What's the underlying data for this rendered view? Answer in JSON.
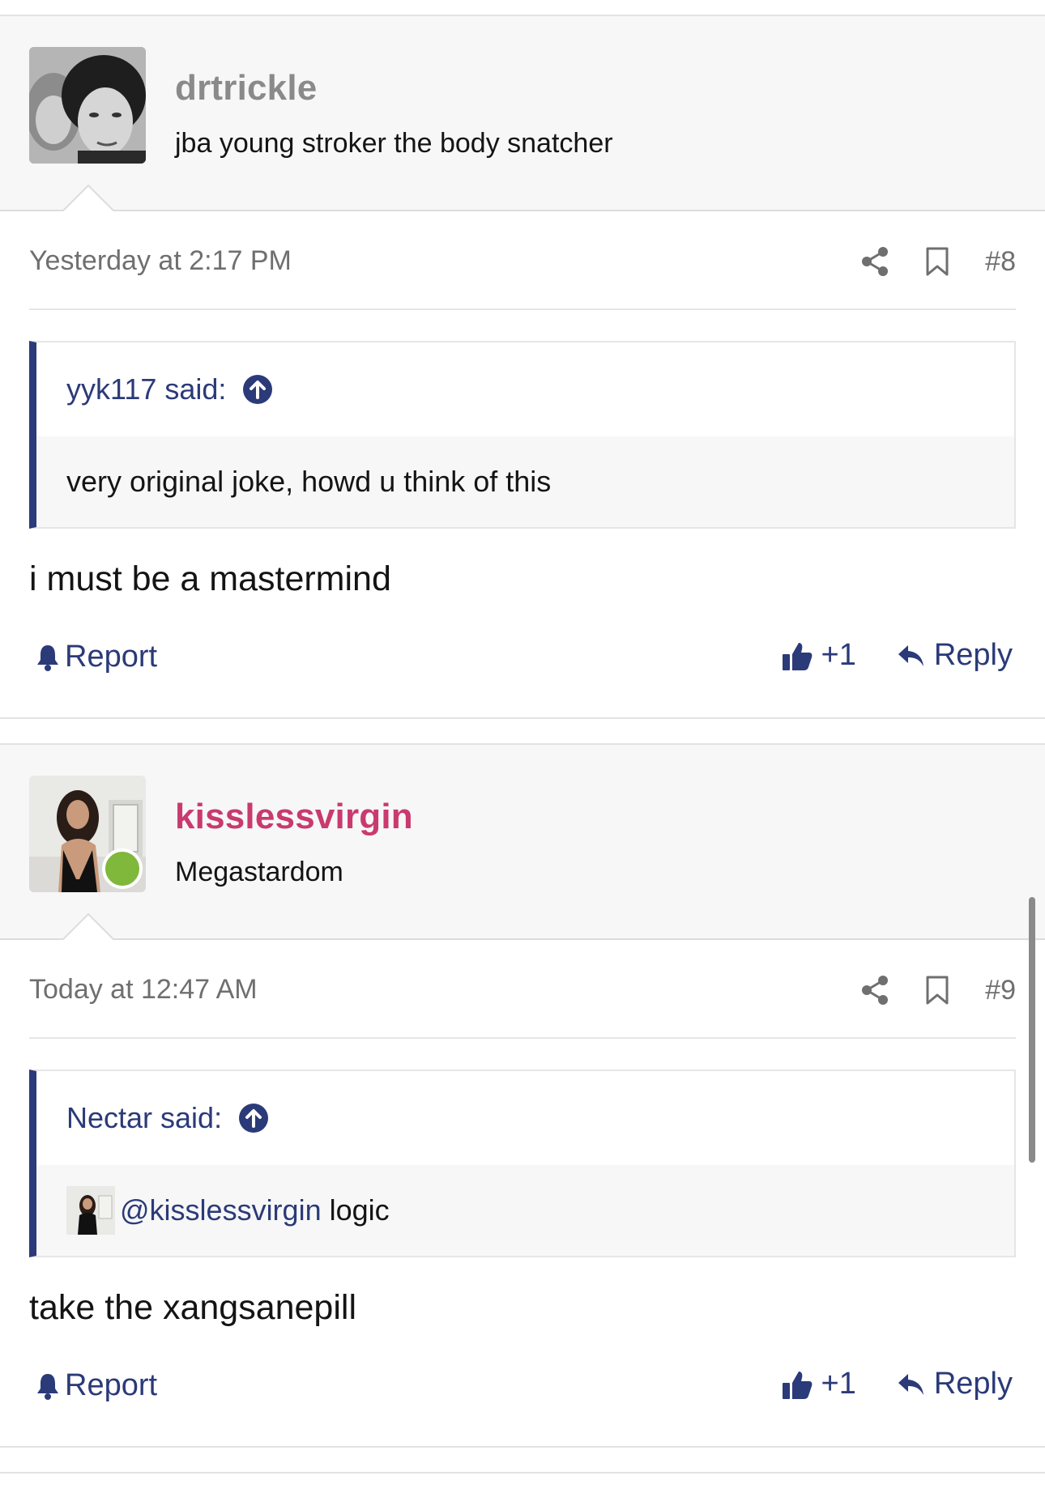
{
  "colors": {
    "link": "#2b3a78",
    "username_default": "#8a8a8a",
    "username_highlight": "#c93a6e",
    "online": "#7fb83a",
    "meta_text": "#6f6f6f"
  },
  "posts": [
    {
      "username": "drtrickle",
      "user_title": "jba young stroker the body snatcher",
      "avatar_icon": "user-avatar-photo",
      "date": "Yesterday at 2:17 PM",
      "post_number": "#8",
      "quote": {
        "attribution": "yyk117 said:",
        "text": "very original joke, howd u think of this"
      },
      "message": "i must be a mastermind",
      "report_label": "Report",
      "like_label": "+1",
      "reply_label": "Reply"
    },
    {
      "username": "kisslessvirgin",
      "user_title": "Megastardom",
      "avatar_icon": "user-avatar-photo",
      "online": true,
      "date": "Today at 12:47 AM",
      "post_number": "#9",
      "quote": {
        "attribution": "Nectar said:",
        "mention": "@kisslessvirgin",
        "text": "logic"
      },
      "message": "take the xangsanepill",
      "report_label": "Report",
      "like_label": "+1",
      "reply_label": "Reply"
    }
  ]
}
